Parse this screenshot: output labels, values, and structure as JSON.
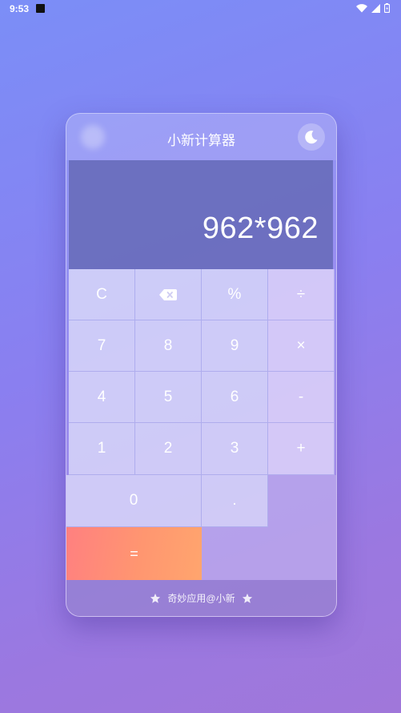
{
  "status_bar": {
    "time": "9:53"
  },
  "header": {
    "title": "小新计算器",
    "theme_icon": "moon-icon"
  },
  "display": {
    "expression": "962*962"
  },
  "keys": {
    "clear": "C",
    "backspace_icon": "backspace-icon",
    "percent": "%",
    "divide": "÷",
    "seven": "7",
    "eight": "8",
    "nine": "9",
    "multiply": "×",
    "four": "4",
    "five": "5",
    "six": "6",
    "minus": "-",
    "one": "1",
    "two": "2",
    "three": "3",
    "plus": "+",
    "zero": "0",
    "dot": ".",
    "equals": "="
  },
  "footer": {
    "text": "奇妙应用@小新",
    "icon": "star-icon"
  },
  "colors": {
    "background_start": "#7b8ef7",
    "background_end": "#a077da",
    "equals_start": "#ff8080",
    "equals_end": "#ffa56e"
  }
}
